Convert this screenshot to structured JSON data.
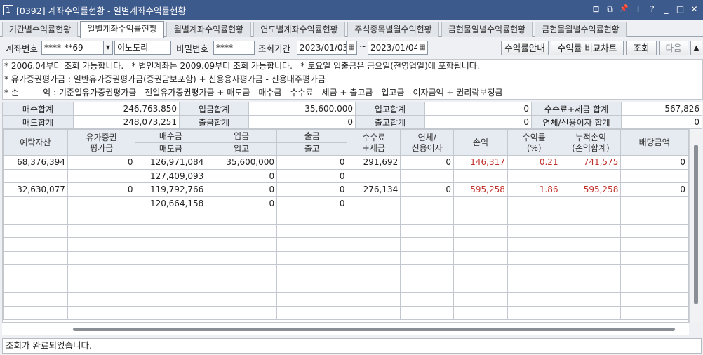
{
  "window": {
    "number": "1",
    "title": "[0392] 계좌수익률현황 - 일별계좌수익률현황",
    "controls": [
      "⊡",
      "⧉",
      "📌",
      "T",
      "?",
      "_",
      "□",
      "✕"
    ]
  },
  "tabs": [
    {
      "label": "기간별수익률현황"
    },
    {
      "label": "일별계좌수익률현황",
      "active": true
    },
    {
      "label": "월별계좌수익률현황"
    },
    {
      "label": "연도별계좌수익률현황"
    },
    {
      "label": "주식종목별월수익현황"
    },
    {
      "label": "금현물일별수익률현황"
    },
    {
      "label": "금현물월별수익률현황"
    }
  ],
  "search": {
    "account_label": "계좌번호",
    "account_value": "****-**69",
    "account_name": "이노도리",
    "password_label": "비밀번호",
    "password_value": "****",
    "period_label": "조회기간",
    "date_from": "2023/01/03",
    "tilde": "~",
    "date_to": "2023/01/04",
    "buttons": {
      "guide": "수익률안내",
      "compare": "수익률 비교차트",
      "query": "조회",
      "next": "다음"
    }
  },
  "notes": [
    "* 2006.04부터 조회 가능합니다.   * 법인계좌는 2009.09부터 조회 가능합니다.   * 토요일 입출금은 금요일(전영업일)에 포함됩니다.",
    "* 유가증권평가금 : 일반유가증권평가금(증권담보포함) + 신용융자평가금 - 신용대주평가금",
    "* 손         익 : 기준일유가증권평가금 - 전일유가증권평가금 + 매도금 - 매수금 - 수수료 - 세금 + 출고금 - 입고금 - 이자금액 + 권리락보정금"
  ],
  "summary": {
    "rows": [
      [
        {
          "label": "매수합계",
          "value": "246,763,850"
        },
        {
          "label": "입금합계",
          "value": "35,600,000"
        },
        {
          "label": "입고합계",
          "value": "0"
        },
        {
          "label": "수수료+세금 합계",
          "value": "567,826"
        }
      ],
      [
        {
          "label": "매도합계",
          "value": "248,073,251"
        },
        {
          "label": "출금합계",
          "value": "0"
        },
        {
          "label": "출고합계",
          "value": "0"
        },
        {
          "label": "연체/신용이자 합계",
          "value": "0"
        }
      ]
    ]
  },
  "grid": {
    "headers": {
      "deposit": "예탁자산",
      "securities": "유가증권\n평가금",
      "buy": "매수금",
      "sell": "매도금",
      "in_money": "입금",
      "in_stock": "입고",
      "out_money": "출금",
      "out_stock": "출고",
      "fee": "수수료\n+세금",
      "interest": "연체/\n신용이자",
      "pnl": "손익",
      "rate": "수익률\n(%)",
      "cum_pnl": "누적손익\n(손익합계)",
      "dividend": "배당금액"
    },
    "records": [
      {
        "deposit": "68,376,394",
        "securities": "0",
        "buy": "126,971,084",
        "sell": "127,409,093",
        "in_money": "35,600,000",
        "in_stock": "0",
        "out_money": "0",
        "out_stock": "0",
        "fee": "291,692",
        "interest": "0",
        "pnl": "146,317",
        "rate": "0.21",
        "cum_pnl": "741,575",
        "dividend": "0"
      },
      {
        "deposit": "32,630,077",
        "securities": "0",
        "buy": "119,792,766",
        "sell": "120,664,158",
        "in_money": "0",
        "in_stock": "0",
        "out_money": "0",
        "out_stock": "0",
        "fee": "276,134",
        "interest": "0",
        "pnl": "595,258",
        "rate": "1.86",
        "cum_pnl": "595,258",
        "dividend": "0"
      }
    ],
    "empty_record_count": 4
  },
  "status": {
    "text": "조회가 완료되었습니다."
  }
}
